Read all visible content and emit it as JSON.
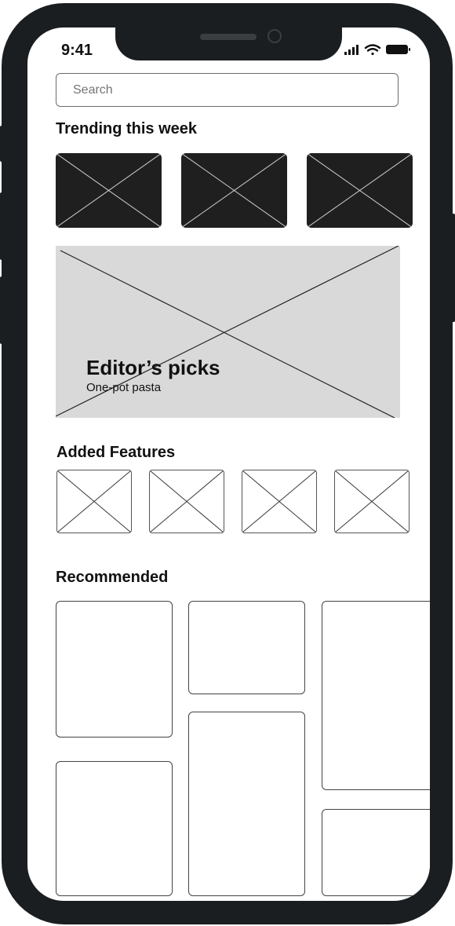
{
  "status_bar": {
    "time": "9:41"
  },
  "search": {
    "placeholder": "Search"
  },
  "sections": {
    "trending": "Trending this week",
    "added_features": "Added Features",
    "recommended": "Recommended"
  },
  "hero": {
    "title": "Editor’s picks",
    "subtitle": "One-pot pasta"
  },
  "icons": {
    "signal": "signal-icon",
    "wifi": "wifi-icon",
    "battery": "battery-icon"
  },
  "colors": {
    "frame": "#1b1e20",
    "tile_dark": "#1f1f1f",
    "hero_bg": "#d9d9d9"
  }
}
